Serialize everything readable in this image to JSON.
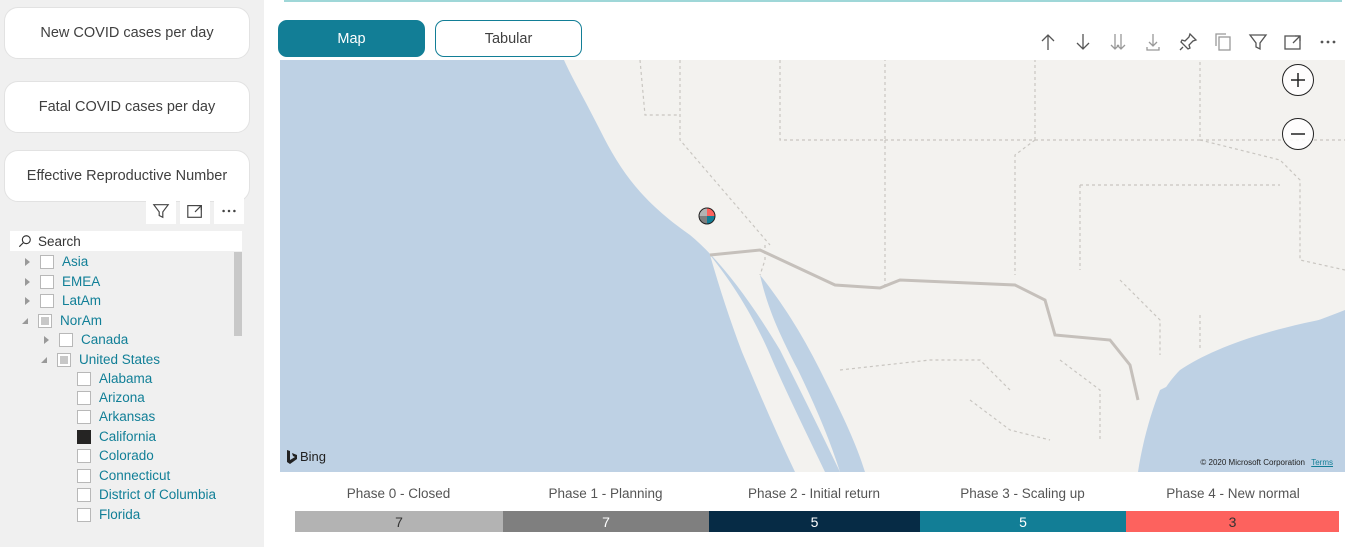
{
  "sidebar": {
    "cards": [
      {
        "label": "New COVID cases per day"
      },
      {
        "label": "Fatal COVID cases per day"
      },
      {
        "label": "Effective Reproductive Number"
      }
    ],
    "search": {
      "placeholder": "Search"
    },
    "tree": [
      {
        "label": "Asia",
        "level": 0,
        "state": "unchecked",
        "expanded": false
      },
      {
        "label": "EMEA",
        "level": 0,
        "state": "unchecked",
        "expanded": false
      },
      {
        "label": "LatAm",
        "level": 0,
        "state": "unchecked",
        "expanded": false
      },
      {
        "label": "NorAm",
        "level": 0,
        "state": "partial",
        "expanded": true
      },
      {
        "label": "Canada",
        "level": 1,
        "state": "unchecked",
        "expanded": false
      },
      {
        "label": "United States",
        "level": 1,
        "state": "partial",
        "expanded": true
      },
      {
        "label": "Alabama",
        "level": 2,
        "state": "unchecked"
      },
      {
        "label": "Arizona",
        "level": 2,
        "state": "unchecked"
      },
      {
        "label": "Arkansas",
        "level": 2,
        "state": "unchecked"
      },
      {
        "label": "California",
        "level": 2,
        "state": "checked"
      },
      {
        "label": "Colorado",
        "level": 2,
        "state": "unchecked"
      },
      {
        "label": "Connecticut",
        "level": 2,
        "state": "unchecked"
      },
      {
        "label": "District of Columbia",
        "level": 2,
        "state": "unchecked"
      },
      {
        "label": "Florida",
        "level": 2,
        "state": "unchecked"
      }
    ]
  },
  "toggles": {
    "map": "Map",
    "tabular": "Tabular"
  },
  "map": {
    "attribution": "Bing",
    "copyright": "© 2020 Microsoft Corporation",
    "terms": "Terms"
  },
  "phases": [
    {
      "label": "Phase 0 - Closed",
      "count": "7",
      "color": "#b3b3b3",
      "text_color": "#333333"
    },
    {
      "label": "Phase 1 - Planning",
      "count": "7",
      "color": "#7f7f7f",
      "text_color": "#ffffff"
    },
    {
      "label": "Phase 2 - Initial return",
      "count": "5",
      "color": "#062b45",
      "text_color": "#ffffff"
    },
    {
      "label": "Phase 3 - Scaling up",
      "count": "5",
      "color": "#127e96",
      "text_color": "#ffffff"
    },
    {
      "label": "Phase 4 - New normal",
      "count": "3",
      "color": "#fd625e",
      "text_color": "#333333"
    }
  ]
}
